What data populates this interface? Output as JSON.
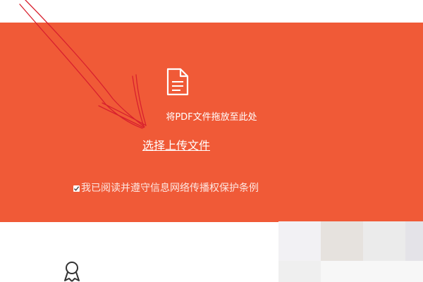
{
  "upload": {
    "drop_hint": "将PDF文件拖放至此处",
    "select_label": "选择上传文件",
    "agreement_text": "我已阅读并遵守信息网络传播权保护条例",
    "agreement_checked": true
  },
  "icons": {
    "document": "document-icon",
    "checkbox": "checkbox-checked-icon",
    "annotation": "hand-drawn-arrow-icon",
    "award": "award-icon"
  },
  "colors": {
    "accent": "#f05a37",
    "annotation": "#d8202e",
    "text_on_accent": "#ffffff"
  }
}
